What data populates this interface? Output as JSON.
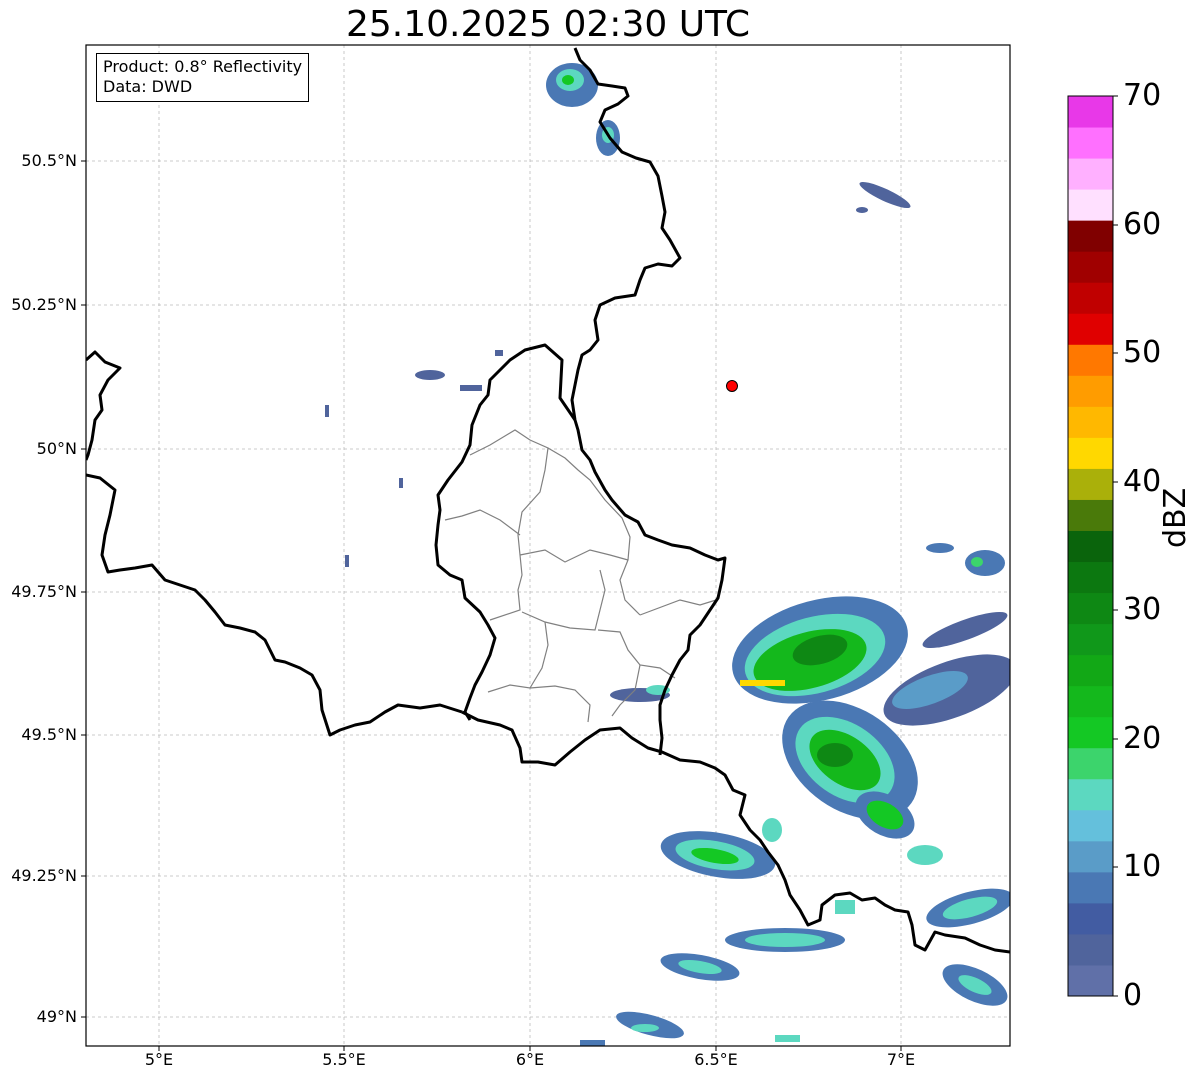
{
  "title": "25.10.2025 02:30 UTC",
  "info": {
    "product": "Product: 0.8° Reflectivity",
    "data": "Data: DWD"
  },
  "axes": {
    "y_ticks": [
      "50.5°N",
      "50.25°N",
      "50°N",
      "49.75°N",
      "49.5°N",
      "49.25°N",
      "49°N"
    ],
    "x_ticks": [
      "5°E",
      "5.5°E",
      "6°E",
      "6.5°E",
      "7°E"
    ]
  },
  "colorbar": {
    "label": "dBZ",
    "ticks": [
      "0",
      "10",
      "20",
      "30",
      "40",
      "50",
      "60",
      "70"
    ],
    "colors": [
      "#6070a8",
      "#50649c",
      "#425ca2",
      "#4a78b4",
      "#5a9cc8",
      "#64c0dc",
      "#5cd8c0",
      "#3cd46c",
      "#14c824",
      "#14b81c",
      "#12a816",
      "#10981a",
      "#0e8814",
      "#0c7810",
      "#0a640c",
      "#4a7a0a",
      "#aab00a",
      "#ffd800",
      "#ffb800",
      "#ff9c00",
      "#ff7800",
      "#e00000",
      "#c00000",
      "#a00000",
      "#800000",
      "#ffe0ff",
      "#ffb0ff",
      "#ff70ff",
      "#e838e8"
    ]
  },
  "station": {
    "label": "radar-site"
  },
  "colors": {
    "border": "#000000",
    "admin": "#808080",
    "grid": "#bbbbbb",
    "station": "#ff0000"
  }
}
